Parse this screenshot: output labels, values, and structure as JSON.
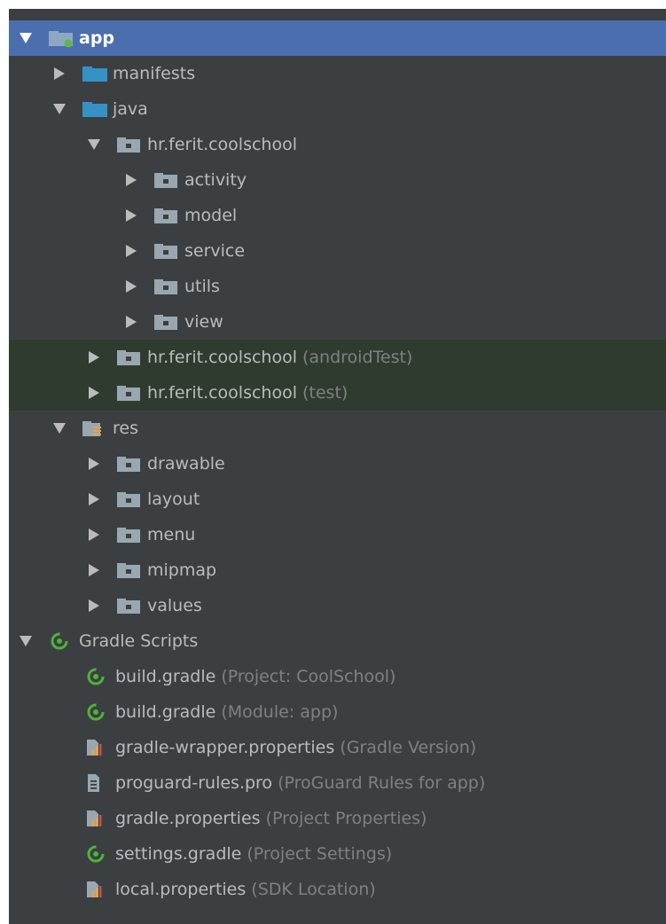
{
  "tree": {
    "app": {
      "label": "app"
    },
    "manifests": {
      "label": "manifests"
    },
    "java": {
      "label": "java"
    },
    "pkg_main": {
      "label": "hr.ferit.coolschool"
    },
    "activity": {
      "label": "activity"
    },
    "model": {
      "label": "model"
    },
    "service": {
      "label": "service"
    },
    "utils": {
      "label": "utils"
    },
    "view": {
      "label": "view"
    },
    "pkg_android_test": {
      "label": "hr.ferit.coolschool",
      "hint": "(androidTest)"
    },
    "pkg_test": {
      "label": "hr.ferit.coolschool",
      "hint": "(test)"
    },
    "res": {
      "label": "res"
    },
    "drawable": {
      "label": "drawable"
    },
    "layout": {
      "label": "layout"
    },
    "menu": {
      "label": "menu"
    },
    "mipmap": {
      "label": "mipmap"
    },
    "values": {
      "label": "values"
    },
    "gradle_scripts": {
      "label": "Gradle Scripts"
    },
    "build_project": {
      "label": "build.gradle",
      "hint": "(Project: CoolSchool)"
    },
    "build_module": {
      "label": "build.gradle",
      "hint": "(Module: app)"
    },
    "gradle_wrapper": {
      "label": "gradle-wrapper.properties",
      "hint": "(Gradle Version)"
    },
    "proguard": {
      "label": "proguard-rules.pro",
      "hint": "(ProGuard Rules for app)"
    },
    "gradle_properties": {
      "label": "gradle.properties",
      "hint": "(Project Properties)"
    },
    "settings": {
      "label": "settings.gradle",
      "hint": "(Project Settings)"
    },
    "local_properties": {
      "label": "local.properties",
      "hint": "(SDK Location)"
    }
  },
  "colors": {
    "background": "#3c3f41",
    "selection": "#4b6eaf",
    "test_highlight": "#2f3b2f",
    "text": "#bbbbbb",
    "hint": "#808080",
    "folder_blue": "#3592c4",
    "package_gray": "#9aa7b0",
    "gradle_green": "#4fb23a"
  },
  "icons": {
    "expanded": "triangle-down-icon",
    "collapsed": "triangle-right-icon",
    "module": "module-folder-icon",
    "source": "source-folder-icon",
    "package": "package-icon",
    "resources": "resources-folder-icon",
    "gradle": "gradle-icon",
    "properties": "properties-file-icon",
    "text_file": "text-file-icon"
  }
}
